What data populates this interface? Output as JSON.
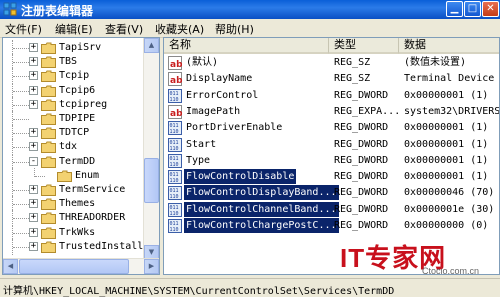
{
  "window": {
    "title": "注册表编辑器"
  },
  "menu": [
    "文件(F)",
    "编辑(E)",
    "查看(V)",
    "收藏夹(A)",
    "帮助(H)"
  ],
  "tree": {
    "items": [
      {
        "label": "TapiSrv",
        "expander": "+"
      },
      {
        "label": "TBS",
        "expander": "+"
      },
      {
        "label": "Tcpip",
        "expander": "+"
      },
      {
        "label": "Tcpip6",
        "expander": "+"
      },
      {
        "label": "tcpipreg",
        "expander": "+"
      },
      {
        "label": "TDPIPE",
        "expander": ""
      },
      {
        "label": "TDTCP",
        "expander": "+"
      },
      {
        "label": "tdx",
        "expander": "+"
      },
      {
        "label": "TermDD",
        "expander": "-"
      },
      {
        "label": "Enum",
        "expander": ""
      },
      {
        "label": "TermService",
        "expander": "+"
      },
      {
        "label": "Themes",
        "expander": "+"
      },
      {
        "label": "THREADORDER",
        "expander": "+"
      },
      {
        "label": "TrkWks",
        "expander": "+"
      },
      {
        "label": "TrustedInstalle",
        "expander": "+"
      }
    ]
  },
  "columns": {
    "name": "名称",
    "type": "类型",
    "data": "数据"
  },
  "values": [
    {
      "icon": "ab",
      "name": "(默认)",
      "type": "REG_SZ",
      "data": "(数值未设置)",
      "selected": false
    },
    {
      "icon": "ab",
      "name": "DisplayName",
      "type": "REG_SZ",
      "data": "Terminal Device I",
      "selected": false
    },
    {
      "icon": "bin",
      "name": "ErrorControl",
      "type": "REG_DWORD",
      "data": "0x00000001 (1)",
      "selected": false
    },
    {
      "icon": "ab",
      "name": "ImagePath",
      "type": "REG_EXPA...",
      "data": "system32\\DRIVERS\\",
      "selected": false
    },
    {
      "icon": "bin",
      "name": "PortDriverEnable",
      "type": "REG_DWORD",
      "data": "0x00000001 (1)",
      "selected": false
    },
    {
      "icon": "bin",
      "name": "Start",
      "type": "REG_DWORD",
      "data": "0x00000001 (1)",
      "selected": false
    },
    {
      "icon": "bin",
      "name": "Type",
      "type": "REG_DWORD",
      "data": "0x00000001 (1)",
      "selected": false
    },
    {
      "icon": "bin",
      "name": "FlowControlDisable",
      "type": "REG_DWORD",
      "data": "0x00000001 (1)",
      "selected": true
    },
    {
      "icon": "bin",
      "name": "FlowControlDisplayBand...",
      "type": "REG_DWORD",
      "data": "0x00000046 (70)",
      "selected": true
    },
    {
      "icon": "bin",
      "name": "FlowControlChannelBand...",
      "type": "REG_DWORD",
      "data": "0x0000001e (30)",
      "selected": true
    },
    {
      "icon": "bin",
      "name": "FlowControlChargePostC...",
      "type": "REG_DWORD",
      "data": "0x00000000 (0)",
      "selected": true
    }
  ],
  "status": {
    "path": "计算机\\HKEY_LOCAL_MACHINE\\SYSTEM\\CurrentControlSet\\Services\\TermDD"
  },
  "watermark": {
    "main": "IT专家网",
    "sub": "Ctocio.com.cn"
  },
  "colors": {
    "selection": "#0a246a",
    "titlebar": "#0a5fd8",
    "watermark": "#c8101c"
  }
}
